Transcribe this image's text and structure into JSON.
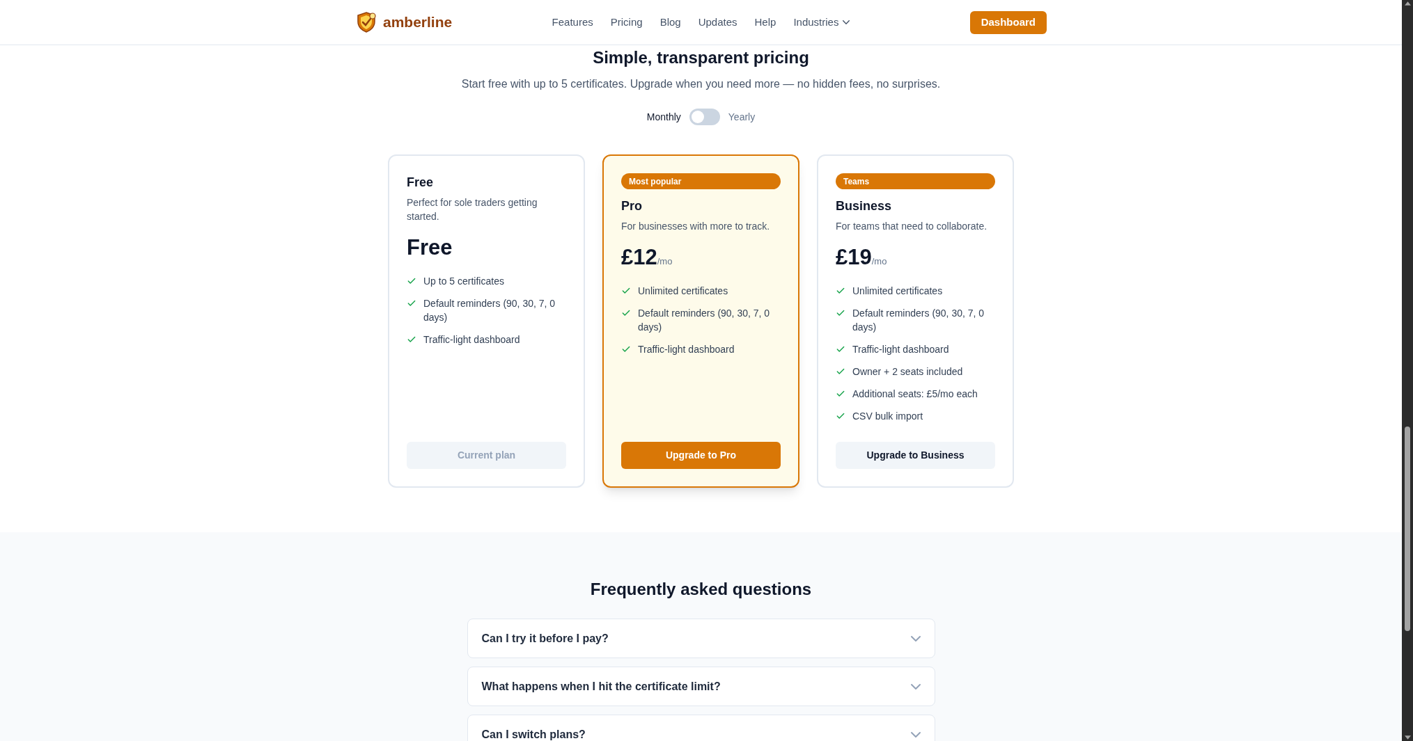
{
  "header": {
    "brand": "amberline",
    "nav": [
      {
        "label": "Features",
        "has_menu": false
      },
      {
        "label": "Pricing",
        "has_menu": false
      },
      {
        "label": "Blog",
        "has_menu": false
      },
      {
        "label": "Updates",
        "has_menu": false
      },
      {
        "label": "Help",
        "has_menu": false
      },
      {
        "label": "Industries",
        "has_menu": true
      }
    ],
    "cta": "Dashboard"
  },
  "pricing": {
    "title": "Simple, transparent pricing",
    "subtitle": "Start free with up to 5 certificates. Upgrade when you need more — no hidden fees, no surprises.",
    "billing_toggle": {
      "left_label": "Monthly",
      "right_label": "Yearly",
      "on": false
    },
    "plans": [
      {
        "name": "Free",
        "description": "Perfect for sole traders getting started.",
        "price": "Free",
        "highlighted": false,
        "features": [
          "Up to 5 certificates",
          "Default reminders (90, 30, 7, 0 days)",
          "Traffic-light dashboard"
        ],
        "button": {
          "label": "Current plan",
          "kind": "disabled"
        }
      },
      {
        "badge": "Most popular",
        "name": "Pro",
        "description": "For businesses with more to track.",
        "price": "£12",
        "price_suffix": "/mo",
        "highlighted": true,
        "features": [
          "Unlimited certificates",
          "Default reminders (90, 30, 7, 0 days)",
          "Traffic-light dashboard"
        ],
        "button": {
          "label": "Upgrade to Pro",
          "kind": "primary"
        }
      },
      {
        "badge": "Teams",
        "name": "Business",
        "description": "For teams that need to collaborate.",
        "price": "£19",
        "price_suffix": "/mo",
        "highlighted": false,
        "features": [
          "Unlimited certificates",
          "Default reminders (90, 30, 7, 0 days)",
          "Traffic-light dashboard",
          "Owner + 2 seats included",
          "Additional seats: £5/mo each",
          "CSV bulk import"
        ],
        "button": {
          "label": "Upgrade to Business",
          "kind": "secondary"
        }
      }
    ]
  },
  "faq": {
    "title": "Frequently asked questions",
    "items": [
      {
        "question": "Can I try it before I pay?",
        "expanded": false
      },
      {
        "question": "What happens when I hit the certificate limit?",
        "expanded": false
      },
      {
        "question": "Can I switch plans?",
        "expanded": false
      }
    ]
  }
}
